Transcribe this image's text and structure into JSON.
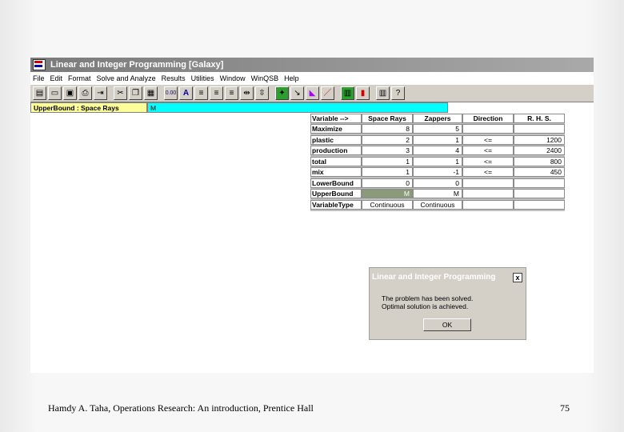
{
  "window": {
    "title": "Linear and Integer Programming   [Galaxy]"
  },
  "menu": [
    "File",
    "Edit",
    "Format",
    "Solve and Analyze",
    "Results",
    "Utilities",
    "Window",
    "WinQSB",
    "Help"
  ],
  "toolbar_icons": [
    "open-icon",
    "new-icon",
    "save-icon",
    "print-icon",
    "exit-icon",
    "cut-icon",
    "copy-icon",
    "paste-icon",
    "number-format-icon",
    "font-icon",
    "align-left-icon",
    "align-center-icon",
    "align-right-icon",
    "column-width-icon",
    "row-height-icon",
    "solve-icon",
    "graph-icon",
    "chart-icon",
    "cancel-icon",
    "table-icon",
    "bar-chart-icon",
    "matrix-icon",
    "help-icon"
  ],
  "editbar": {
    "cell_ref": "UpperBound : Space Rays",
    "value": "M"
  },
  "grid": {
    "headers": [
      "Variable  -->",
      "Space Rays",
      "Zappers",
      "Direction",
      "R. H. S."
    ],
    "rows": [
      {
        "label": "Maximize",
        "c1": "8",
        "c2": "5",
        "dir": "",
        "rhs": ""
      },
      {
        "label": "plastic",
        "c1": "2",
        "c2": "1",
        "dir": "<=",
        "rhs": "1200"
      },
      {
        "label": "production",
        "c1": "3",
        "c2": "4",
        "dir": "<=",
        "rhs": "2400"
      },
      {
        "label": "total",
        "c1": "1",
        "c2": "1",
        "dir": "<=",
        "rhs": "800"
      },
      {
        "label": "mix",
        "c1": "1",
        "c2": "-1",
        "dir": "<=",
        "rhs": "450"
      },
      {
        "label": "LowerBound",
        "c1": "0",
        "c2": "0",
        "dir": "",
        "rhs": ""
      },
      {
        "label": "UpperBound",
        "c1": "M",
        "c2": "M",
        "dir": "",
        "rhs": ""
      },
      {
        "label": "VariableType",
        "c1": "Continuous",
        "c2": "Continuous",
        "dir": "",
        "rhs": ""
      }
    ]
  },
  "dialog": {
    "title": "Linear and Integer Programming",
    "close": "x",
    "message_line1": "The problem has been solved.",
    "message_line2": "Optimal solution is achieved.",
    "ok_label": "OK"
  },
  "footer": {
    "caption": "Hamdy A. Taha, Operations Research: An introduction, Prentice Hall",
    "page_number": "75"
  }
}
